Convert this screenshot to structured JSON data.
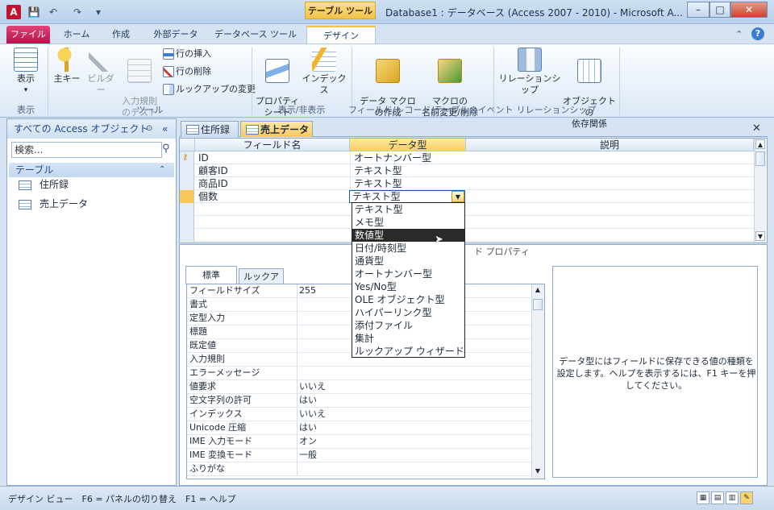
{
  "titlebar": {
    "app_icon_letter": "A",
    "context_tab": "テーブル ツール",
    "title": "Database1 : データベース (Access 2007 - 2010) - Microsoft A...",
    "minimize": "–",
    "maximize": "□",
    "close": "✕"
  },
  "ribbon_tabs": [
    "ファイル",
    "ホーム",
    "作成",
    "外部データ",
    "データベース ツール",
    "デザイン"
  ],
  "ribbon": {
    "view": {
      "label": "表示",
      "group": "表示"
    },
    "tools": {
      "primary_key": "主キー",
      "builder": "ビルダー",
      "test_rules": "入力規則\nのテスト",
      "insert_rows": "行の挿入",
      "delete_rows": "行の削除",
      "modify_lookups": "ルックアップの変更",
      "group": "ツール"
    },
    "show_hide": {
      "property_sheet": "プロパティ\nシート",
      "indexes": "インデックス",
      "group": "表示/非表示"
    },
    "events": {
      "data_macros": "データ マクロ\nの作成",
      "rename_macro": "マクロの\n名前変更/削除",
      "group": "フィールド/レコード/テーブルのイベント"
    },
    "relationships": {
      "relationships": "リレーションシップ",
      "dependencies": "オブジェクトの\n依存関係",
      "group": "リレーションシップ"
    }
  },
  "nav": {
    "header": "すべての Access オブジェクト",
    "search_placeholder": "検索...",
    "group": "テーブル",
    "items": [
      "住所録",
      "売上データ"
    ]
  },
  "doc_tabs": [
    "住所録",
    "売上データ"
  ],
  "grid": {
    "columns": [
      "フィールド名",
      "データ型",
      "説明"
    ],
    "rows": [
      {
        "name": "ID",
        "type": "オートナンバー型",
        "primary_key": true
      },
      {
        "name": "顧客ID",
        "type": "テキスト型"
      },
      {
        "name": "商品ID",
        "type": "テキスト型"
      },
      {
        "name": "個数",
        "type": "テキスト型"
      }
    ]
  },
  "dropdown": {
    "current": "テキスト型",
    "options": [
      "テキスト型",
      "メモ型",
      "数値型",
      "日付/時刻型",
      "通貨型",
      "オートナンバー型",
      "Yes/No型",
      "OLE オブジェクト型",
      "ハイパーリンク型",
      "添付ファイル",
      "集計",
      "ルックアップ ウィザード"
    ],
    "highlighted": "数値型"
  },
  "props": {
    "section_title": "ド プロパティ",
    "tabs": [
      "標準",
      "ルックアップ"
    ],
    "rows": [
      {
        "name": "フィールドサイズ",
        "value": "255"
      },
      {
        "name": "書式",
        "value": ""
      },
      {
        "name": "定型入力",
        "value": ""
      },
      {
        "name": "標題",
        "value": ""
      },
      {
        "name": "既定値",
        "value": ""
      },
      {
        "name": "入力規則",
        "value": ""
      },
      {
        "name": "エラーメッセージ",
        "value": ""
      },
      {
        "name": "値要求",
        "value": "いいえ"
      },
      {
        "name": "空文字列の許可",
        "value": "はい"
      },
      {
        "name": "インデックス",
        "value": "いいえ"
      },
      {
        "name": "Unicode 圧縮",
        "value": "はい"
      },
      {
        "name": "IME 入力モード",
        "value": "オン"
      },
      {
        "name": "IME 変換モード",
        "value": "一般"
      },
      {
        "name": "ふりがな",
        "value": ""
      }
    ],
    "help": "データ型にはフィールドに保存できる値の種類を設定します。ヘルプを表示するには、F1 キーを押してください。"
  },
  "status": {
    "text": "デザイン ビュー　F6 = パネルの切り替え　F1 = ヘルプ"
  }
}
